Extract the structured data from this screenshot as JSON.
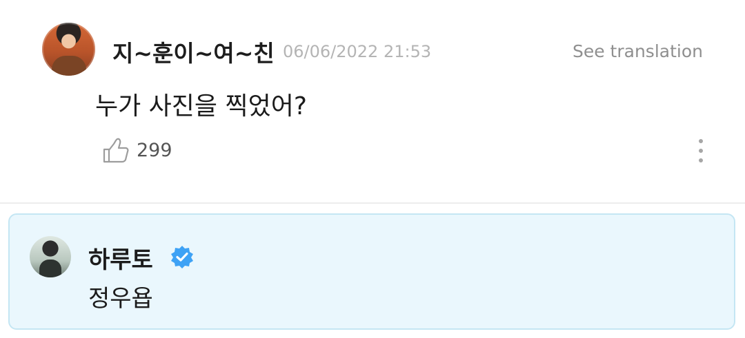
{
  "comment": {
    "author": "지~훈이~여~친",
    "timestamp": "06/06/2022 21:53",
    "translate_label": "See translation",
    "text": "누가 사진을 찍었어?",
    "like_count": "299"
  },
  "reply": {
    "author": "하루토",
    "text": "정우욥",
    "verified": true
  },
  "colors": {
    "reply_background": "#eaf7fd",
    "reply_border": "#c4e6f3",
    "verified_blue": "#3ea2f5"
  },
  "icons": [
    "thumbs-up-icon",
    "more-vertical-icon",
    "verified-badge-icon"
  ]
}
